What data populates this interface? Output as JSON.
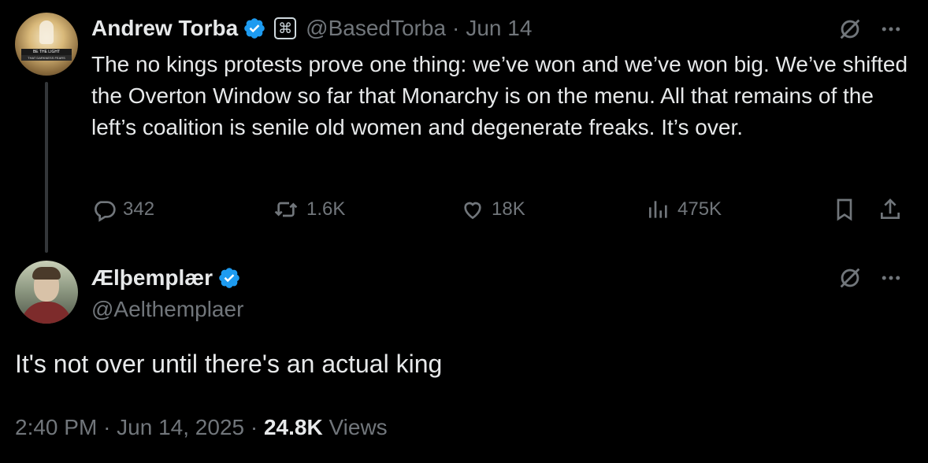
{
  "tweet": {
    "author_name": "Andrew Torba",
    "handle": "@BasedTorba",
    "separator": "·",
    "date": "Jun 14",
    "avatar_text_1": "BE THE LIGHT",
    "avatar_text_2": "THAT DARKNESS FEARS",
    "text": "The no kings protests prove one thing: we’ve won and we’ve won big. We’ve shifted the Overton Window so far that Monarchy is on the menu. All that remains of the left’s coalition is senile old women and degenerate freaks. It’s over.",
    "replies": "342",
    "reposts": "1.6K",
    "likes": "18K",
    "views": "475K"
  },
  "reply": {
    "author_name": "Ælþemplær",
    "handle": "@Aelthemplaer",
    "text": "It's not over until there's an actual king",
    "time": "2:40 PM",
    "sep1": "·",
    "date": "Jun 14, 2025",
    "sep2": "·",
    "views_count": "24.8K",
    "views_label": "Views"
  },
  "colors": {
    "background": "#000000",
    "text": "#e7e9ea",
    "muted": "#71767b",
    "verified": "#1d9bf0"
  }
}
